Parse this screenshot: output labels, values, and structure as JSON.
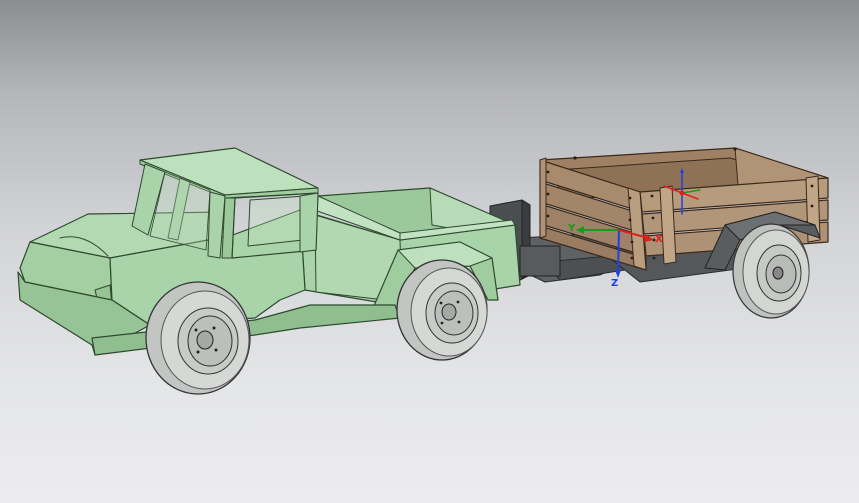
{
  "viewport": {
    "background_top": "#8c8d91",
    "background_bottom": "#ececee"
  },
  "model": {
    "truck_color": "#a9d3a9",
    "truck_edge": "#2e4a2e",
    "box_color": "#a8896b",
    "box_edge": "#3a2a1c",
    "frame_color": "#5c5f62",
    "tire_color": "#cfd2cf"
  },
  "axis_triad": {
    "x_label": "X",
    "y_label": "Y",
    "z_label": "Z",
    "x_color": "#e02020",
    "y_color": "#1a9a1a",
    "z_color": "#2040e0"
  }
}
